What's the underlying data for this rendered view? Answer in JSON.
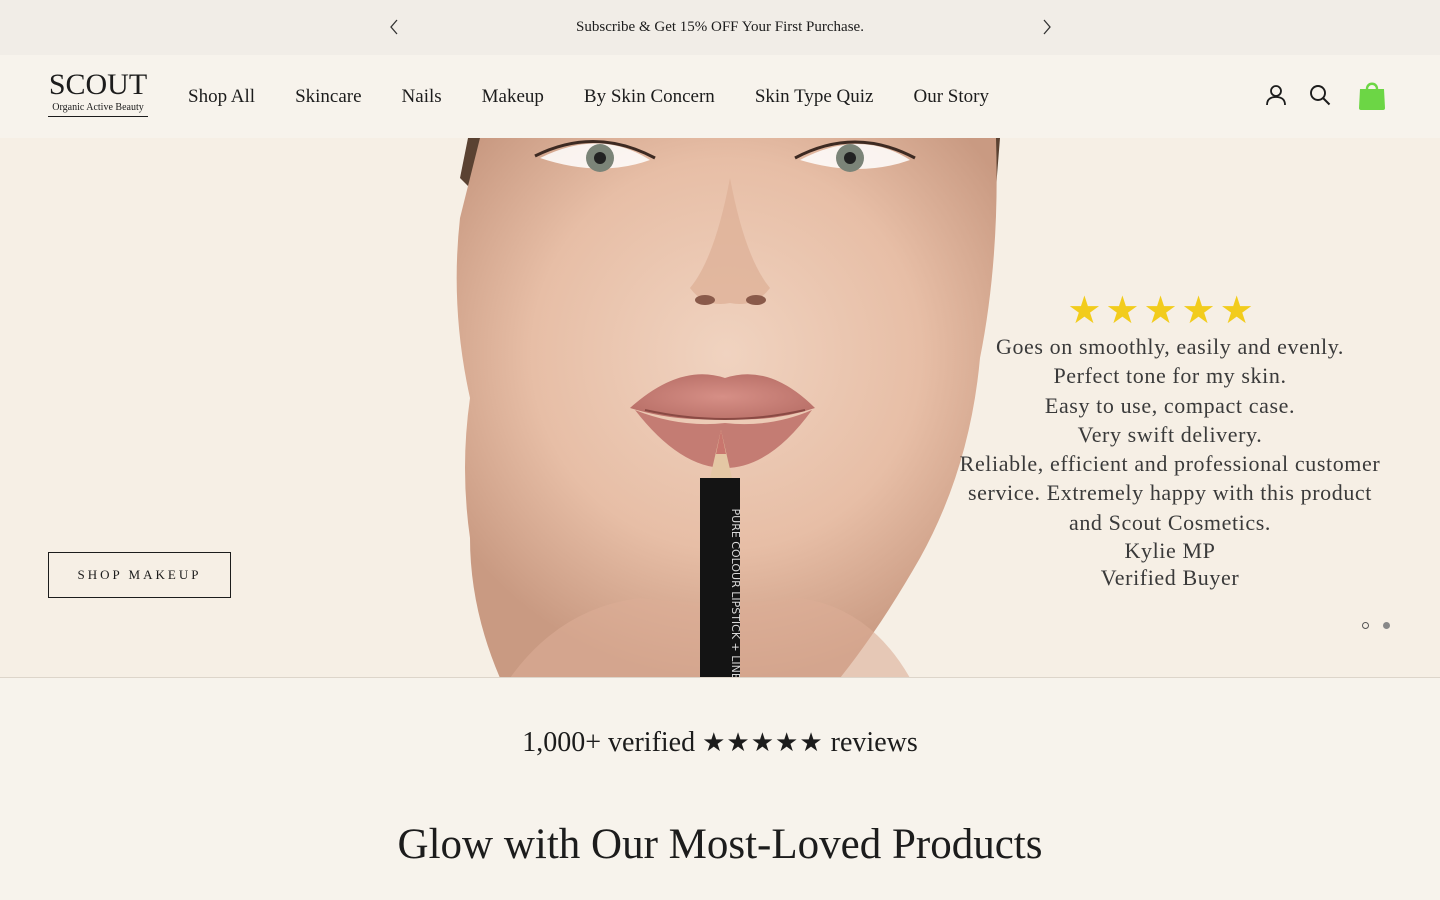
{
  "announcement": {
    "text": "Subscribe & Get 15% OFF Your First Purchase."
  },
  "header": {
    "logo_main": "SCOUT",
    "logo_sub": "Organic Active Beauty",
    "nav": [
      {
        "label": "Shop All"
      },
      {
        "label": "Skincare"
      },
      {
        "label": "Nails"
      },
      {
        "label": "Makeup"
      },
      {
        "label": "By Skin Concern"
      },
      {
        "label": "Skin Type Quiz"
      },
      {
        "label": "Our Story"
      }
    ],
    "icons": [
      "account-icon",
      "search-icon",
      "shopping-bag-icon"
    ],
    "cart_color": "#6cd645"
  },
  "hero": {
    "button_label": "SHOP MAKEUP",
    "pencil_text": "PURE COLOUR LIPSTICK + LINER",
    "review": {
      "stars": "★★★★★",
      "star_color": "#f2cc1c",
      "lines": [
        "Goes on smoothly, easily and evenly.",
        "Perfect tone for my skin.",
        "Easy to use, compact case.",
        "Very swift delivery.",
        "Reliable, efficient and professional customer",
        "service. Extremely happy with this product",
        "and Scout Cosmetics."
      ],
      "author": "Kylie MP",
      "author_badge": "Verified Buyer"
    },
    "slides": {
      "current": 1,
      "total": 2
    }
  },
  "reviews_strip": {
    "prefix": "1,000+ verified",
    "stars": "★★★★★",
    "suffix": "reviews"
  },
  "section": {
    "title": "Glow with Our Most-Loved Products"
  }
}
